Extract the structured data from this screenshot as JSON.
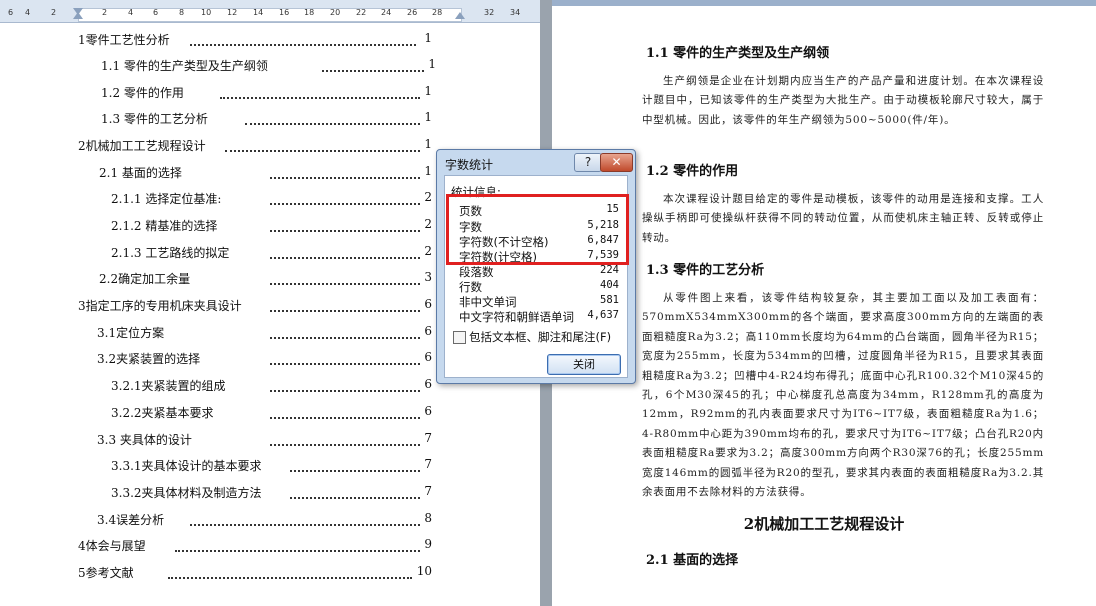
{
  "ruler": {
    "ticks": [
      "6",
      "4",
      "2",
      "2",
      "4",
      "6",
      "8",
      "10",
      "12",
      "14",
      "16",
      "18",
      "20",
      "22",
      "24",
      "26",
      "28",
      "32",
      "34"
    ]
  },
  "toc": [
    {
      "text": "1零件工艺性分析",
      "page": "1"
    },
    {
      "text": "1.1  零件的生产类型及生产纲领",
      "page": "1"
    },
    {
      "text": "1.2  零件的作用",
      "page": "1"
    },
    {
      "text": "1.3  零件的工艺分析",
      "page": "1"
    },
    {
      "text": "2机械加工工艺规程设计",
      "page": "1"
    },
    {
      "text": "2.1 基面的选择",
      "page": "1"
    },
    {
      "text": "2.1.1 选择定位基准:",
      "page": "2"
    },
    {
      "text": "2.1.2 精基准的选择",
      "page": "2"
    },
    {
      "text": "2.1.3    工艺路线的拟定",
      "page": "2"
    },
    {
      "text": "2.2确定加工余量",
      "page": "3"
    },
    {
      "text": "3指定工序的专用机床夹具设计",
      "page": "6"
    },
    {
      "text": "3.1定位方案",
      "page": "6"
    },
    {
      "text": "3.2夹紧装置的选择",
      "page": "6"
    },
    {
      "text": "3.2.1夹紧装置的组成",
      "page": "6"
    },
    {
      "text": "3.2.2夹紧基本要求",
      "page": "6"
    },
    {
      "text": "3.3 夹具体的设计",
      "page": "7"
    },
    {
      "text": "3.3.1夹具体设计的基本要求",
      "page": "7"
    },
    {
      "text": "3.3.2夹具体材料及制造方法",
      "page": "7"
    },
    {
      "text": "3.4误差分析",
      "page": "8"
    },
    {
      "text": "4体会与展望",
      "page": "9"
    },
    {
      "text": "5参考文献",
      "page": "10"
    }
  ],
  "dialog": {
    "title": "字数统计",
    "help": "?",
    "close_x": "✕",
    "stats_label": "统计信息:",
    "stats": [
      {
        "label": "页数",
        "value": "15"
      },
      {
        "label": "字数",
        "value": "5,218"
      },
      {
        "label": "字符数(不计空格)",
        "value": "6,847"
      },
      {
        "label": "字符数(计空格)",
        "value": "7,539"
      },
      {
        "label": "段落数",
        "value": "224"
      },
      {
        "label": "行数",
        "value": "404"
      },
      {
        "label": "非中文单词",
        "value": "581"
      },
      {
        "label": "中文字符和朝鲜语单词",
        "value": "4,637"
      }
    ],
    "include_label": "包括文本框、脚注和尾注(F)",
    "close_button": "关闭"
  },
  "doc": {
    "h1_1": "1.1 零件的生产类型及生产纲领",
    "p1": "生产纲领是企业在计划期内应当生产的产品产量和进度计划。在本次课程设计题目中，已知该零件的生产类型为大批生产。由于动模板轮廓尺寸较大，属于中型机械。因此，该零件的年生产纲领为500~5000(件/年)。",
    "h1_2": "1.2 零件的作用",
    "p2": "本次课程设计题目给定的零件是动模板，该零件的动用是连接和支撑。工人操纵手柄即可使操纵杆获得不同的转动位置，从而使机床主轴正转、反转或停止转动。",
    "h1_3": "1.3  零件的工艺分析",
    "p3": "从零件图上来看，该零件结构较复杂，其主要加工面以及加工表面有：570mmX534mmX300mm的各个端面，要求高度300mm方向的左端面的表面粗糙度Ra为3.2；高110mm长度均为64mm的凸台端面，圆角半径为R15；宽度为255mm，长度为534mm的凹槽，过度圆角半径为R15，且要求其表面粗糙度Ra为3.2；凹槽中4-R24均布得孔；底面中心孔R100.32个M10深45的孔，6个M30深45的孔；中心梯度孔总高度为34mm，R128mm孔的高度为12mm，R92mm的孔内表面要求尺寸为IT6~IT7级，表面粗糙度Ra为1.6；4-R80mm中心距为390mm均布的孔，要求尺寸为IT6~IT7级；凸台孔R20内表面粗糙度Ra要求为3.2；高度300mm方向两个R30深76的孔；长度255mm宽度146mm的圆弧半径为R20的型孔，要求其内表面的表面粗糙度Ra为3.2.其余表面用不去除材料的方法获得。",
    "chapter2": "2机械加工工艺规程设计",
    "h2_1": "2.1 基面的选择"
  }
}
